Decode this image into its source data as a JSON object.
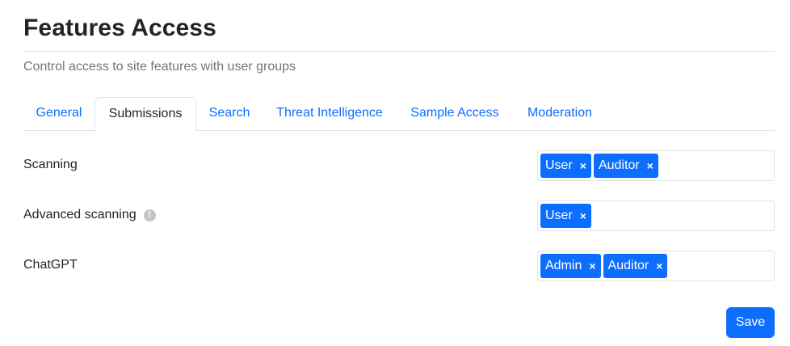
{
  "page": {
    "title": "Features Access",
    "subtitle": "Control access to site features with user groups"
  },
  "tabs": [
    {
      "label": "General",
      "active": false
    },
    {
      "label": "Submissions",
      "active": true
    },
    {
      "label": "Search",
      "active": false
    },
    {
      "label": "Threat Intelligence",
      "active": false
    },
    {
      "label": "Sample Access",
      "active": false
    },
    {
      "label": "Moderation",
      "active": false
    }
  ],
  "features": [
    {
      "label": "Scanning",
      "info_icon": false,
      "groups": [
        "User",
        "Auditor"
      ]
    },
    {
      "label": "Advanced scanning",
      "info_icon": true,
      "info_icon_name": "info-icon",
      "groups": [
        "User"
      ]
    },
    {
      "label": "ChatGPT",
      "info_icon": false,
      "groups": [
        "Admin",
        "Auditor"
      ]
    }
  ],
  "tag_remove_glyph": "×",
  "info_glyph": "!",
  "save_label": "Save",
  "colors": {
    "accent": "#0d6efd",
    "text": "#212529",
    "muted": "#6c757d",
    "border": "#dee2e6"
  }
}
